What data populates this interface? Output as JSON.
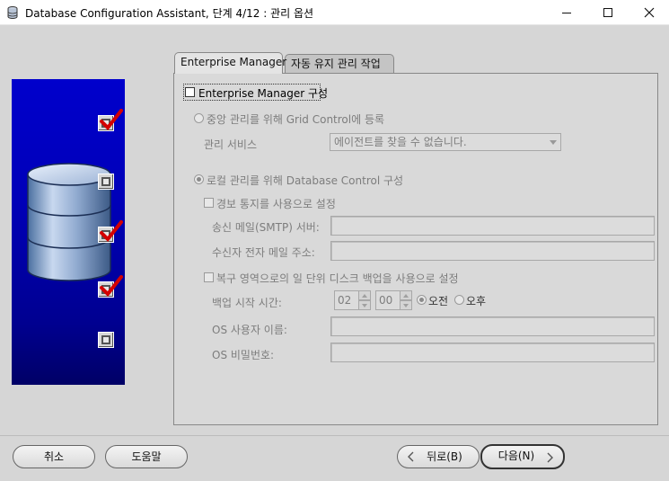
{
  "window": {
    "title": "Database Configuration Assistant, 단계 4/12 : 관리 옵션"
  },
  "tabs": [
    {
      "label": "Enterprise Manager",
      "active": true
    },
    {
      "label": "자동 유지 관리 작업",
      "active": false
    }
  ],
  "em": {
    "configure_label": "Enterprise Manager 구성",
    "configure_checked": false,
    "grid_radio_label": "중앙 관리를 위해 Grid Control에 등록",
    "mgmt_service_label": "관리 서비스",
    "mgmt_service_value": "에이전트를 찾을 수 없습니다.",
    "db_control_radio_label": "로컬 관리를 위해 Database Control 구성",
    "alert_checkbox_label": "경보 통지를 사용으로 설정",
    "smtp_label": "송신 메일(SMTP) 서버:",
    "smtp_value": "",
    "recipient_label": "수신자 전자 메일 주소:",
    "recipient_value": "",
    "backup_checkbox_label": "복구 영역으로의 일 단위 디스크 백업을 사용으로 설정",
    "backup_time_label": "백업 시작 시간:",
    "backup_hour": "02",
    "backup_minute": "00",
    "am_label": "오전",
    "pm_label": "오후",
    "am_selected": true,
    "os_user_label": "OS 사용자 이름:",
    "os_user_value": "",
    "os_password_label": "OS 비밀번호:",
    "os_password_value": ""
  },
  "steps": [
    {
      "status": "complete"
    },
    {
      "status": "incomplete"
    },
    {
      "status": "complete"
    },
    {
      "status": "complete"
    },
    {
      "status": "incomplete"
    }
  ],
  "buttons": {
    "cancel": "취소",
    "help": "도움말",
    "back": "뒤로(B)",
    "next": "다음(N)"
  },
  "colors": {
    "side_panel": "#0000cc",
    "check_red": "#d40000"
  }
}
